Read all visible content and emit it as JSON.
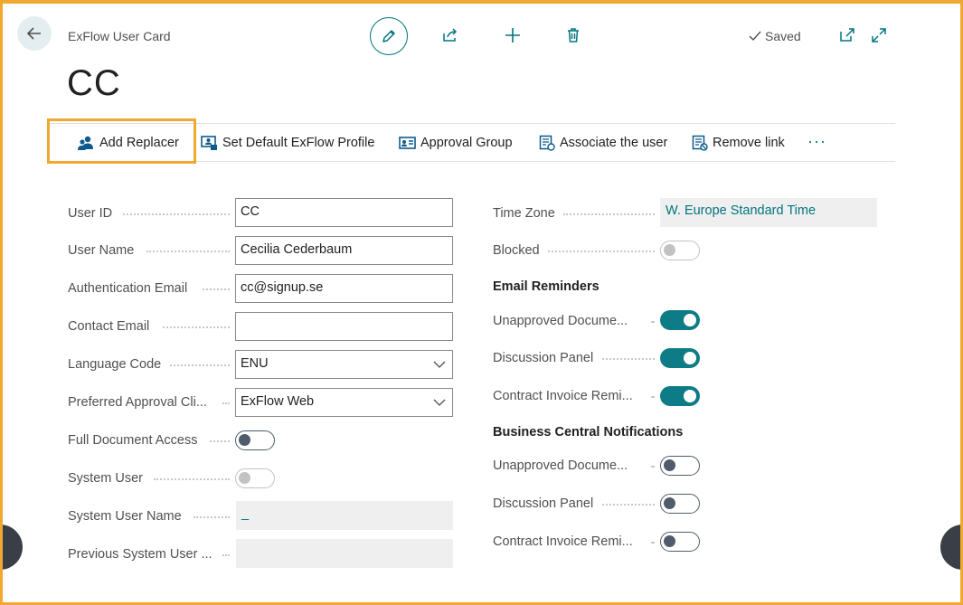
{
  "header": {
    "caption": "ExFlow User Card",
    "title": "CC",
    "saved_label": "Saved"
  },
  "actions": [
    {
      "label": "Add Replacer",
      "icon": "users-icon"
    },
    {
      "label": "Set Default ExFlow Profile",
      "icon": "profile-icon"
    },
    {
      "label": "Approval Group",
      "icon": "id-card-icon"
    },
    {
      "label": "Associate the user",
      "icon": "document-link-icon"
    },
    {
      "label": "Remove link",
      "icon": "document-unlink-icon"
    }
  ],
  "more_label": "···",
  "left_fields": {
    "user_id": {
      "label": "User ID",
      "value": "CC"
    },
    "user_name": {
      "label": "User Name",
      "value": "Cecilia Cederbaum"
    },
    "auth_email": {
      "label": "Authentication Email",
      "value": "cc@signup.se"
    },
    "contact_email": {
      "label": "Contact Email",
      "value": ""
    },
    "language_code": {
      "label": "Language Code",
      "value": "ENU"
    },
    "approval_client": {
      "label": "Preferred Approval Cli...",
      "value": "ExFlow Web"
    },
    "full_doc_access": {
      "label": "Full Document Access",
      "state": "off"
    },
    "system_user": {
      "label": "System User",
      "state": "disabled"
    },
    "system_user_name": {
      "label": "System User Name",
      "value": "_"
    },
    "prev_system_user": {
      "label": "Previous System User ...",
      "value": ""
    }
  },
  "right_fields": {
    "time_zone": {
      "label": "Time Zone",
      "value": "W. Europe Standard Time"
    },
    "blocked": {
      "label": "Blocked",
      "state": "disabled"
    },
    "email_reminders": {
      "heading": "Email Reminders",
      "items": [
        {
          "label": "Unapproved Docume...",
          "state": "on"
        },
        {
          "label": "Discussion Panel",
          "state": "on"
        },
        {
          "label": "Contract Invoice Remi...",
          "state": "on"
        }
      ]
    },
    "bc_notifications": {
      "heading": "Business Central Notifications",
      "items": [
        {
          "label": "Unapproved Docume...",
          "state": "off"
        },
        {
          "label": "Discussion Panel",
          "state": "off"
        },
        {
          "label": "Contract Invoice Remi...",
          "state": "off"
        }
      ]
    }
  },
  "colors": {
    "accent": "#00757e",
    "highlight": "#f0a830",
    "toggle_on": "#0e7c86"
  }
}
